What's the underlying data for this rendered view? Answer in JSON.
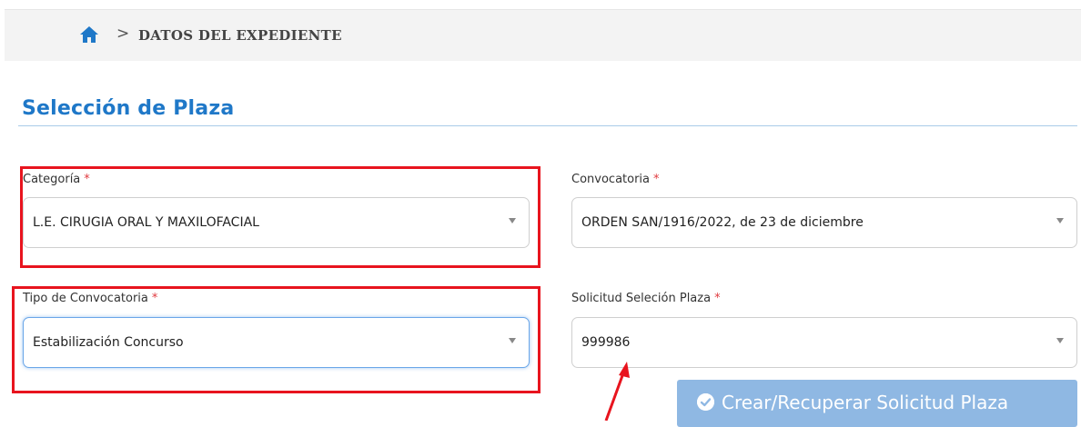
{
  "breadcrumb": {
    "home_icon": "home-icon",
    "separator": ">",
    "current": "DATOS DEL EXPEDIENTE"
  },
  "page": {
    "title": "Selección de Plaza"
  },
  "form": {
    "categoria": {
      "label": "Categoría",
      "required": "*",
      "value": "L.E. CIRUGIA ORAL Y MAXILOFACIAL"
    },
    "convocatoria": {
      "label": "Convocatoria",
      "required": "*",
      "value": "ORDEN SAN/1916/2022, de 23 de diciembre"
    },
    "tipo_convocatoria": {
      "label": "Tipo de Convocatoria",
      "required": "*",
      "value": "Estabilización Concurso"
    },
    "solicitud": {
      "label": "Solicitud Seleción Plaza",
      "required": "*",
      "value": "999986"
    }
  },
  "actions": {
    "create_button": {
      "label": "Crear/Recuperar Solicitud Plaza",
      "icon": "check-circle-icon"
    }
  },
  "annotations": {
    "highlight_color": "#e8141e",
    "arrow_color": "#e8141e"
  },
  "colors": {
    "accent": "#1f78c8",
    "required": "#e0393e",
    "button_bg": "#8fb8e3"
  }
}
